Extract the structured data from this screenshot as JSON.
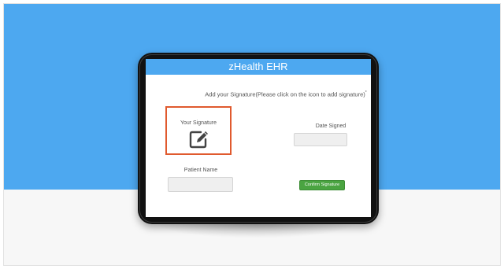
{
  "app": {
    "title": "zHealth EHR"
  },
  "instruction": {
    "text": "Add your Signature(Please click on the icon to add signature)",
    "required_mark": "*"
  },
  "signature": {
    "label": "Your Signature",
    "icon": "edit-icon"
  },
  "date_signed": {
    "label": "Date Signed",
    "value": ""
  },
  "patient_name": {
    "label": "Patient Name",
    "value": ""
  },
  "confirm": {
    "label": "Confirm Signature"
  },
  "colors": {
    "background_blue": "#4da8f0",
    "highlight": "#e05a2e",
    "confirm_green": "#4aa441"
  }
}
